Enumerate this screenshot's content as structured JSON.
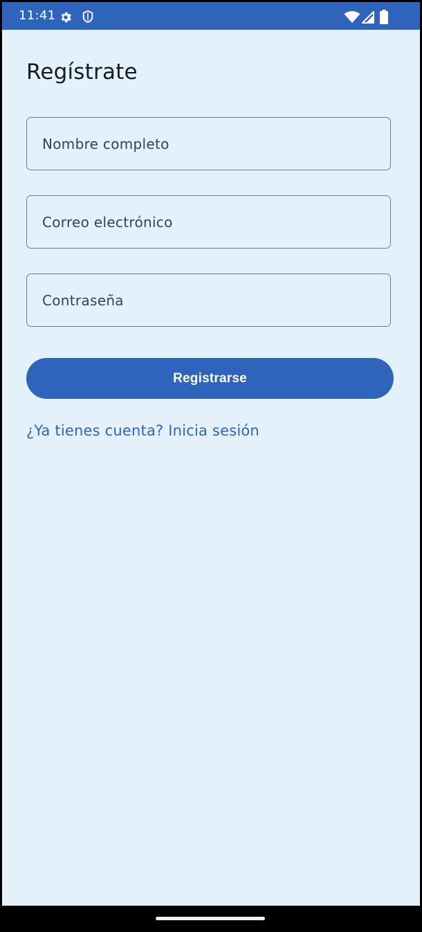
{
  "status_bar": {
    "time": "11:41",
    "icons": [
      "settings-gear-icon",
      "shield-icon",
      "wifi-icon",
      "signal-icon",
      "battery-icon"
    ]
  },
  "screen": {
    "title": "Regístrate",
    "fields": {
      "full_name_placeholder": "Nombre completo",
      "email_placeholder": "Correo electrónico",
      "password_placeholder": "Contraseña"
    },
    "register_label": "Registrarse",
    "login_link": "¿Ya tienes cuenta? Inicia sesión"
  },
  "colors": {
    "primary": "#2f64bd",
    "background": "#e4f1fb",
    "outline": "#6d7b99",
    "text": "#151b26"
  }
}
